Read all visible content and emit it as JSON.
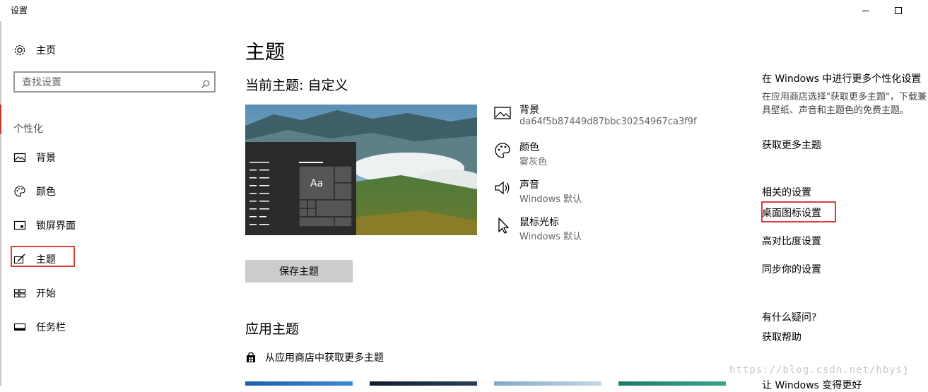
{
  "window": {
    "title": "设置"
  },
  "sidebar": {
    "home_label": "主页",
    "search_placeholder": "查找设置",
    "section_label": "个性化",
    "items": [
      {
        "label": "背景",
        "icon": "image-icon"
      },
      {
        "label": "颜色",
        "icon": "palette-icon"
      },
      {
        "label": "锁屏界面",
        "icon": "lock-screen-icon"
      },
      {
        "label": "主题",
        "icon": "brush-icon",
        "selected": true
      },
      {
        "label": "开始",
        "icon": "start-icon"
      },
      {
        "label": "任务栏",
        "icon": "taskbar-icon"
      }
    ]
  },
  "main": {
    "title": "主题",
    "current_theme": "当前主题: 自定义",
    "preview_sample_text": "Aa",
    "properties": [
      {
        "name": "背景",
        "value": "da64f5b87449d87bbc30254967ca3f9f",
        "icon": "image-icon"
      },
      {
        "name": "颜色",
        "value": "雾灰色",
        "icon": "palette-icon"
      },
      {
        "name": "声音",
        "value": "Windows 默认",
        "icon": "speaker-icon"
      },
      {
        "name": "鼠标光标",
        "value": "Windows 默认",
        "icon": "cursor-icon"
      }
    ],
    "save_button": "保存主题",
    "apply_title": "应用主题",
    "store_link": "从应用商店中获取更多主题"
  },
  "right": {
    "more_heading": "在 Windows 中进行更多个性化设置",
    "more_text": "在应用商店选择\"获取更多主题\"，下载兼具壁纸、声音和主题色的免费主题。",
    "get_more": "获取更多主题",
    "related_heading": "相关的设置",
    "desktop_icons": "桌面图标设置",
    "high_contrast": "高对比度设置",
    "sync": "同步你的设置",
    "question_heading": "有什么疑问?",
    "get_help": "获取帮助",
    "bottom_heading": "让 Windows 变得更好"
  },
  "watermark": "https://blog.csdn.net/hbysj",
  "colors": {
    "highlight_red": "#e03c3c",
    "button_gray": "#cccccc"
  }
}
